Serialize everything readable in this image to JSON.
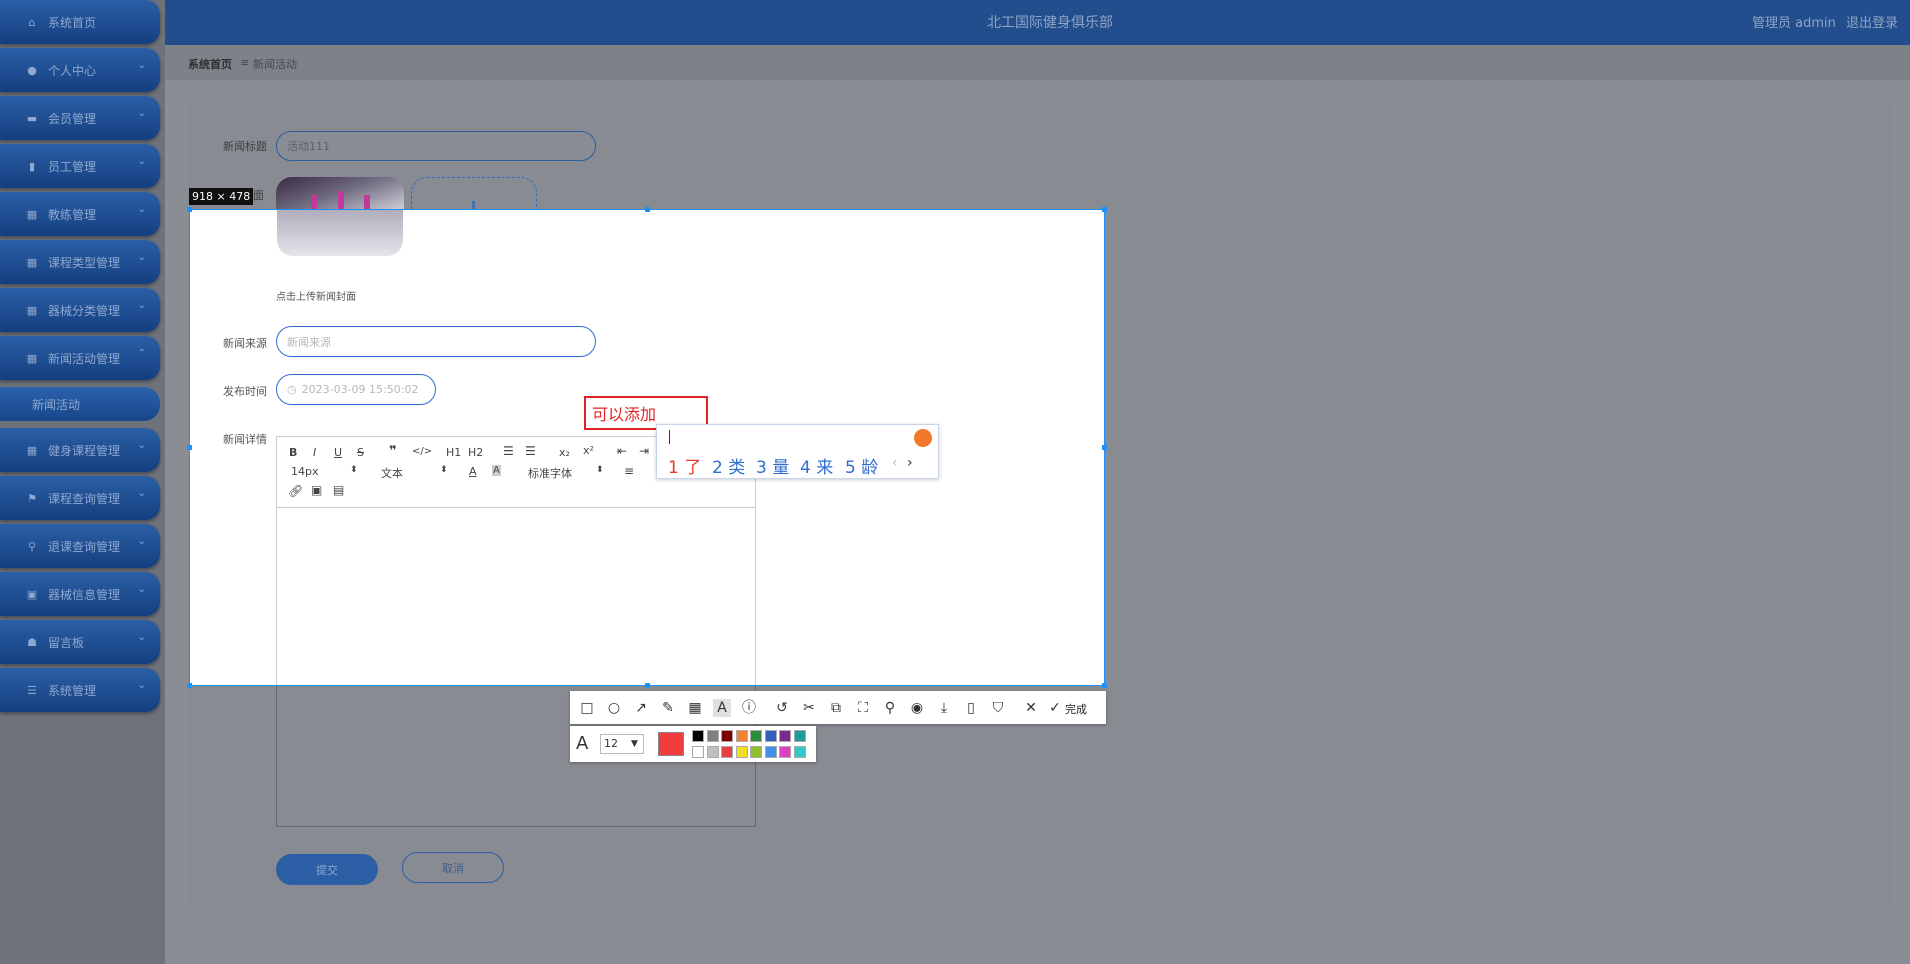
{
  "header": {
    "site_title": "北工国际健身俱乐部",
    "user": "管理员 admin",
    "logout": "退出登录"
  },
  "breadcrumb": {
    "home": "系统首页",
    "sep": "≡",
    "current": "新闻活动"
  },
  "sidebar": {
    "items": [
      {
        "label": "系统首页",
        "icon": "home-icon"
      },
      {
        "label": "个人中心",
        "icon": "user-icon"
      },
      {
        "label": "会员管理",
        "icon": "monitor-icon"
      },
      {
        "label": "员工管理",
        "icon": "clipboard-icon"
      },
      {
        "label": "教练管理",
        "icon": "grid-icon"
      },
      {
        "label": "课程类型管理",
        "icon": "table-icon"
      },
      {
        "label": "器械分类管理",
        "icon": "grid-icon"
      },
      {
        "label": "新闻活动管理",
        "icon": "grid-icon"
      },
      {
        "label": "新闻活动",
        "icon": ""
      },
      {
        "label": "健身课程管理",
        "icon": "grid-icon"
      },
      {
        "label": "课程查询管理",
        "icon": "flag-icon"
      },
      {
        "label": "退课查询管理",
        "icon": "pin-icon"
      },
      {
        "label": "器械信息管理",
        "icon": "form-icon"
      },
      {
        "label": "留言板",
        "icon": "thumb-icon"
      },
      {
        "label": "系统管理",
        "icon": "list-icon"
      }
    ]
  },
  "form": {
    "title_label": "新闻标题",
    "title_value": "活动111",
    "cover_label": "面",
    "upload_hint": "点击上传新闻封面",
    "source_label": "新闻来源",
    "source_placeholder": "新闻来源",
    "time_label": "发布时间",
    "time_value": "2023-03-09 15:50:02",
    "detail_label": "新闻详情",
    "submit": "提交",
    "cancel": "取消"
  },
  "editor": {
    "font_size": "14px",
    "format": "文本",
    "font_family": "标准字体",
    "h1": "H1",
    "h2": "H2"
  },
  "capture": {
    "size_label": "918 × 478",
    "annotation_text": "可以添加",
    "ime_candidates": [
      "1 了",
      "2 类",
      "3 量",
      "4 来",
      "5 龄"
    ],
    "done_label": "完成",
    "font_size": "12",
    "current_color": "#f03c3c",
    "palette_top": [
      "#000000",
      "#808080",
      "#800000",
      "#f58231",
      "#2e8b3e",
      "#3060c0",
      "#7a2a8a",
      "#1a9a9a"
    ],
    "palette_bottom": [
      "#ffffff",
      "#c0c0c0",
      "#e84040",
      "#f0e020",
      "#90c030",
      "#3f8fe8",
      "#e040c0",
      "#30c8c8"
    ]
  }
}
